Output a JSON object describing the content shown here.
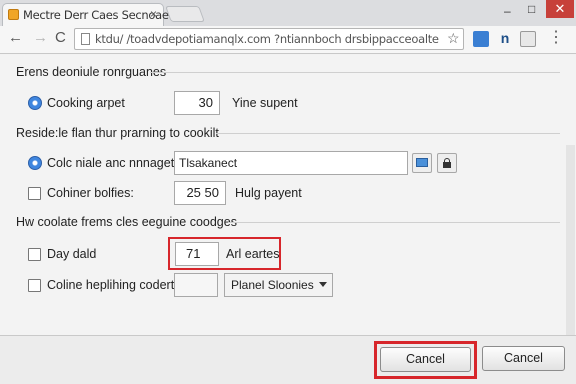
{
  "browser": {
    "tab_title": "Mectre Derr Caes Secnoaet",
    "tab_close": "×",
    "url": "ktdu/ /toadvdepotiamanqlx.com ?ntiannboch drsbippacceoalte",
    "win_min": "–",
    "win_max": "□",
    "win_close": "✕",
    "star_glyph": "☆",
    "back_glyph": "←",
    "forward_glyph": "→",
    "reload_glyph": "C",
    "menu_glyph": "⋮",
    "ext2_glyph": "n"
  },
  "sections": {
    "s1": "Erens deoniule ronrguanes",
    "s2": "Reside:le flan thur prarning to cookilt",
    "s3": "Hw coolate frems cles eeguine coodges"
  },
  "rows": {
    "cooking": {
      "label": "Cooking arpet",
      "value": "30",
      "suffix": "Yine supent",
      "checked": true
    },
    "manager": {
      "label": "Colc niale anc nnnaget:",
      "value": "Tlsakanect",
      "checked": true
    },
    "bolties": {
      "label": "Cohiner bolfies:",
      "value": "25 50",
      "suffix": "Hulg payent",
      "checked": false
    },
    "daydald": {
      "label": "Day dald",
      "value": "71",
      "suffix": "Arl eartes",
      "checked": false
    },
    "coline": {
      "label": "Coline heplihing coderts:",
      "value": "",
      "select": "Planel Sloonies",
      "checked": false
    }
  },
  "footer": {
    "primary": "Cancel",
    "secondary": "Cancel"
  },
  "colors": {
    "highlight": "#d7262b",
    "radio_fill": "#3f86df"
  }
}
